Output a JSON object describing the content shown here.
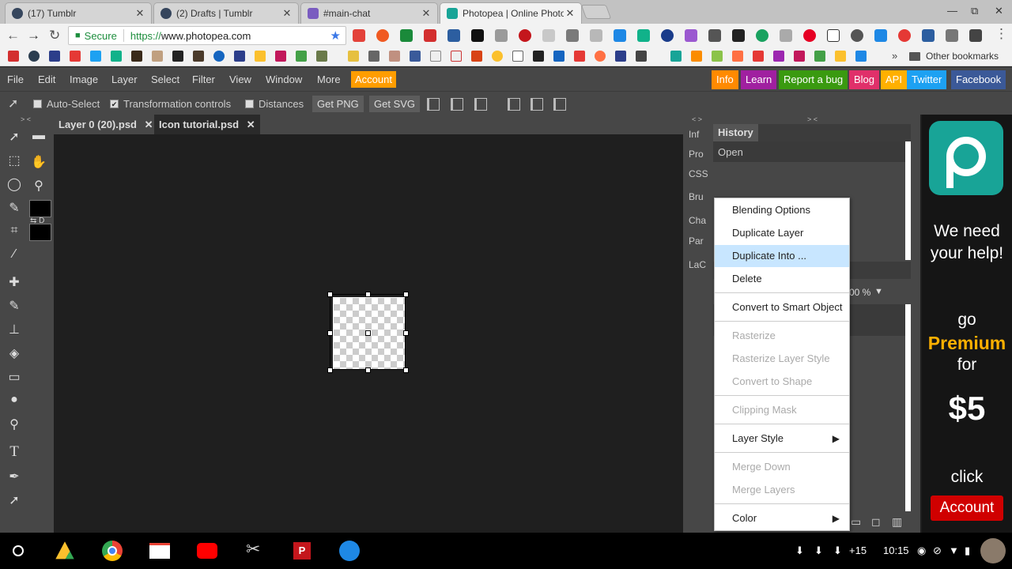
{
  "browser": {
    "tabs": [
      {
        "title": "(17) Tumblr",
        "close": "✕"
      },
      {
        "title": "(2) Drafts | Tumblr",
        "close": "✕"
      },
      {
        "title": "#main-chat",
        "close": "✕"
      },
      {
        "title": "Photopea | Online Photo",
        "close": "✕"
      }
    ],
    "window_controls": {
      "minimize": "—",
      "restore": "⧉",
      "close": "✕"
    },
    "address": {
      "secure": "Secure",
      "url_scheme": "https://",
      "url_host": "www.photopea.com"
    },
    "bookmarks": {
      "other": "Other bookmarks",
      "overflow": "»"
    }
  },
  "photopea": {
    "menus": [
      "File",
      "Edit",
      "Image",
      "Layer",
      "Select",
      "Filter",
      "View",
      "Window",
      "More"
    ],
    "account": "Account",
    "top_links": [
      {
        "label": "Info",
        "color": "#ff8a00"
      },
      {
        "label": "Learn",
        "color": "#a020a0"
      },
      {
        "label": "Report a bug",
        "color": "#3a9a10"
      },
      {
        "label": "Blog",
        "color": "#e0306a"
      },
      {
        "label": "API",
        "color": "#ffb000"
      },
      {
        "label": "Twitter",
        "color": "#1da1f2"
      },
      {
        "label": "Facebook",
        "color": "#3b5998"
      }
    ],
    "options": {
      "auto_select": "Auto-Select",
      "transformation_controls": "Transformation controls",
      "transformation_checked": "✔",
      "distances": "Distances",
      "get_png": "Get PNG",
      "get_svg": "Get SVG"
    },
    "doc_tabs": [
      {
        "title": "Layer 0 (20).psd",
        "close": "✕"
      },
      {
        "title": "Icon tutorial.psd",
        "close": "✕"
      }
    ],
    "collapse_left": "> <",
    "collapse_mid": "< >",
    "collapse_right": "> <",
    "swap_label": "⇆ D",
    "right_strip": [
      "Inf",
      "Pro",
      "CSS",
      "Bru",
      "Cha",
      "Par",
      "LaC"
    ],
    "history": {
      "title": "History",
      "items": [
        "Open"
      ]
    },
    "zoom": "00 %",
    "zoom_arrow": "▼",
    "context_menu": [
      {
        "label": "Blending Options",
        "disabled": false
      },
      {
        "label": "Duplicate Layer",
        "disabled": false
      },
      {
        "label": "Duplicate Into ...",
        "disabled": false,
        "highlight": true
      },
      {
        "label": "Delete",
        "disabled": false
      },
      {
        "label": "Convert to Smart Object",
        "disabled": false
      },
      {
        "label": "Rasterize",
        "disabled": true
      },
      {
        "label": "Rasterize Layer Style",
        "disabled": true
      },
      {
        "label": "Convert to Shape",
        "disabled": true
      },
      {
        "label": "Clipping Mask",
        "disabled": true
      },
      {
        "label": "Layer Style",
        "disabled": false,
        "submenu": true
      },
      {
        "label": "Merge Down",
        "disabled": true
      },
      {
        "label": "Merge Layers",
        "disabled": true
      },
      {
        "label": "Color",
        "disabled": false,
        "submenu": true
      }
    ],
    "submenu_arrow": "▶",
    "ad": {
      "line1": "We need",
      "line2": "your help!",
      "go": "go",
      "premium": "Premium",
      "for": "for",
      "price": "$5",
      "click": "click",
      "account": "Account"
    }
  },
  "shelf": {
    "time": "10:15",
    "notif_count": "+15",
    "apps": [
      "Google Drive",
      "Chrome",
      "Gmail",
      "YouTube",
      "Tools",
      "Polarr",
      "Files"
    ]
  }
}
